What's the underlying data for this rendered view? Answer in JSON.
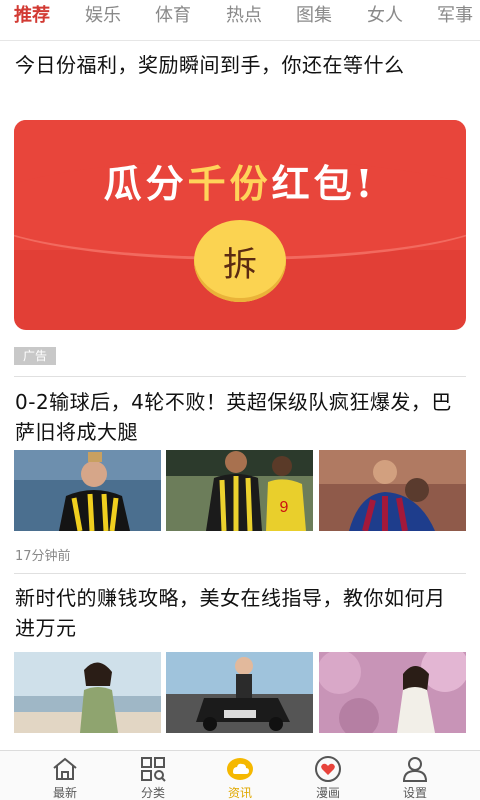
{
  "tabs": [
    "推荐",
    "娱乐",
    "体育",
    "热点",
    "图集",
    "女人",
    "军事"
  ],
  "active_tab": "推荐",
  "ad_card": {
    "title": "今日份福利，奖励瞬间到手，你还在等什么",
    "banner_text_white_1": "瓜分",
    "banner_text_gold": "千份",
    "banner_text_white_2": "红包!",
    "coin_text": "拆",
    "badge": "广告"
  },
  "news_cards": [
    {
      "title": "0-2输球后，4轮不败！英超保级队疯狂爆发，巴萨旧将成大腿",
      "time": "17分钟前"
    },
    {
      "title": "新时代的赚钱攻略，美女在线指导，教你如何月进万元"
    }
  ],
  "bottom_nav": [
    {
      "label": "最新",
      "icon": "home-icon"
    },
    {
      "label": "分类",
      "icon": "grid-search-icon"
    },
    {
      "label": "资讯",
      "icon": "cloud-icon"
    },
    {
      "label": "漫画",
      "icon": "heart-icon"
    },
    {
      "label": "设置",
      "icon": "user-icon"
    }
  ],
  "active_nav": "资讯",
  "colors": {
    "accent_red": "#d23a33",
    "nav_active": "#e0a800",
    "ad_red": "#e23f36",
    "coin_gold": "#fbd351"
  }
}
